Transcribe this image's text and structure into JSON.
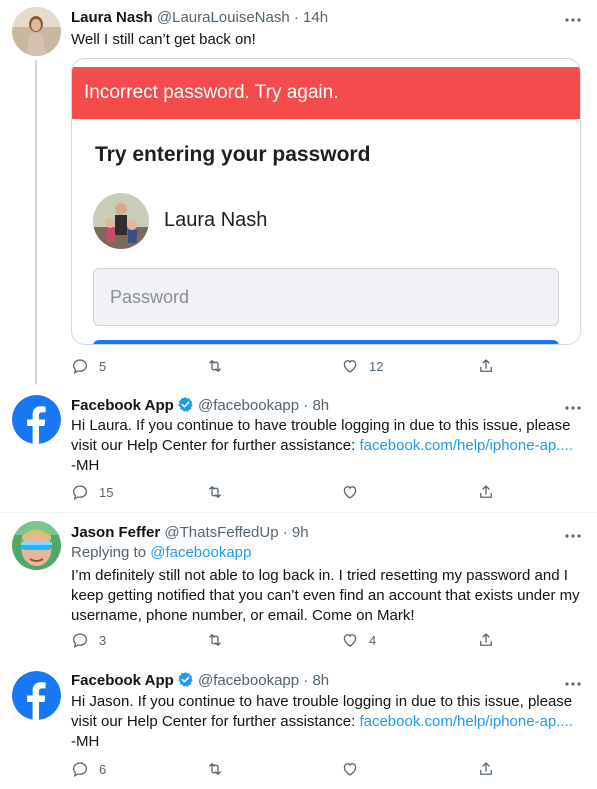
{
  "tweets": [
    {
      "name": "Laura Nash",
      "handle": "@LauraLouiseNash",
      "time": "14h",
      "text": "Well I still can’t get back on!",
      "card": {
        "error": "Incorrect password. Try again.",
        "title": "Try entering your password",
        "account_name": "Laura Nash",
        "password_placeholder": "Password"
      },
      "replies": "5",
      "retweets": "",
      "likes": "12"
    },
    {
      "name": "Facebook App",
      "handle": "@facebookapp",
      "time": "8h",
      "text_before": "Hi Laura. If you continue to have trouble logging in due to this issue, please visit our Help Center for further assistance: ",
      "link": "facebook.com/help/iphone-ap....",
      "text_after": "-MH",
      "replies": "15",
      "retweets": "",
      "likes": ""
    },
    {
      "name": "Jason Feffer",
      "handle": "@ThatsFeffedUp",
      "time": "9h",
      "replying_label": "Replying to ",
      "replying_to": "@facebookapp",
      "text": "I’m definitely still not able to log back in. I tried resetting my password and I keep getting notified that you can’t even find an account that exists under my username, phone number, or email. Come on Mark!",
      "replies": "3",
      "retweets": "",
      "likes": "4"
    },
    {
      "name": "Facebook App",
      "handle": "@facebookapp",
      "time": "8h",
      "text_before": "Hi Jason. If you continue to have trouble logging in due to this issue, please visit our Help Center for further assistance: ",
      "link": "facebook.com/help/iphone-ap....",
      "text_after": "-MH",
      "replies": "6",
      "retweets": "",
      "likes": ""
    }
  ],
  "separator": "·",
  "more_icon": "more-icon",
  "colors": {
    "accent": "#1d9bf0",
    "error": "#f44c4c",
    "facebook_blue": "#1877f2"
  }
}
